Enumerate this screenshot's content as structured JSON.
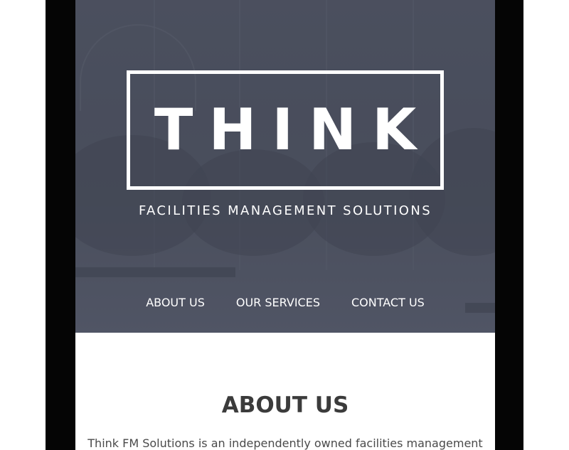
{
  "hero": {
    "logo_text": "THINK",
    "tagline": "FACILITIES MANAGEMENT SOLUTIONS"
  },
  "nav": {
    "items": [
      {
        "label": "ABOUT US"
      },
      {
        "label": "OUR SERVICES"
      },
      {
        "label": "CONTACT US"
      }
    ]
  },
  "about": {
    "title": "ABOUT US",
    "body_first_line": "Think FM Solutions is an independently owned facilities management"
  },
  "colors": {
    "hero_bg": "#4c505e",
    "text_dark": "#3b3b3b",
    "device_frame": "#050505"
  }
}
